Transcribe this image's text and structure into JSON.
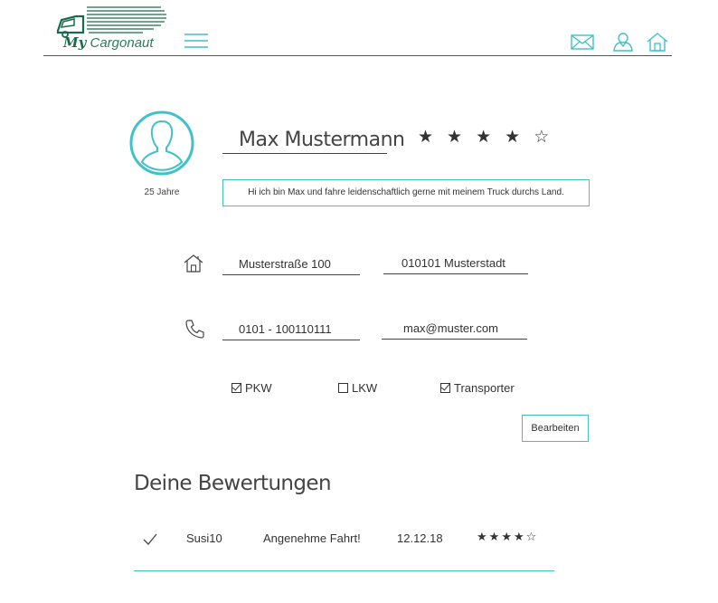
{
  "header": {
    "logo_my": "My",
    "logo_name": "Cargonaut",
    "accent": "#3fc1c9",
    "brand": "#1a6b4a"
  },
  "profile": {
    "name": "Max Mustermann",
    "age": "25 Jahre",
    "rating": 4,
    "rating_max": 5,
    "bio": "Hi ich bin Max und fahre leidenschaftlich gerne mit meinem Truck durchs Land.",
    "street": "Musterstraße 100",
    "city": "010101 Musterstadt",
    "phone": "0101 - 100110111",
    "email": "max@muster.com"
  },
  "vehicles": [
    {
      "label": "PKW",
      "checked": true
    },
    {
      "label": "LKW",
      "checked": false
    },
    {
      "label": "Transporter",
      "checked": true
    }
  ],
  "edit_button": "Bearbeiten",
  "reviews": {
    "title": "Deine Bewertungen",
    "items": [
      {
        "user": "Susi10",
        "text": "Angenehme Fahrt!",
        "date": "12.12.18",
        "rating": 4
      }
    ]
  }
}
